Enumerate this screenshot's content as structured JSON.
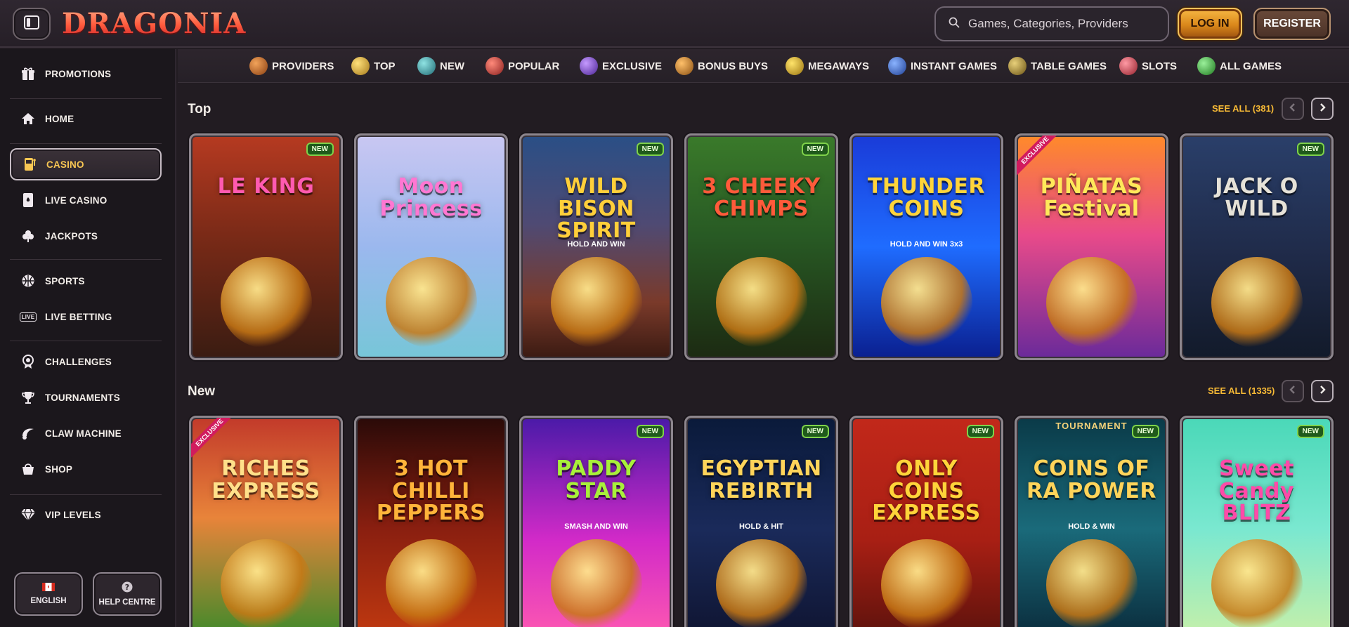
{
  "header": {
    "logo": "DRAGONIA",
    "search_placeholder": "Games, Categories, Providers",
    "login_label": "LOG IN",
    "register_label": "REGISTER"
  },
  "sidebar": {
    "items": [
      {
        "label": "PROMOTIONS",
        "icon": "gift-icon"
      },
      {
        "label": "HOME",
        "icon": "home-icon"
      },
      {
        "label": "CASINO",
        "icon": "slot-machine-icon",
        "active": true
      },
      {
        "label": "LIVE CASINO",
        "icon": "playing-card-icon"
      },
      {
        "label": "JACKPOTS",
        "icon": "clover-icon"
      },
      {
        "label": "SPORTS",
        "icon": "ball-icon"
      },
      {
        "label": "LIVE BETTING",
        "icon": "live-icon"
      },
      {
        "label": "CHALLENGES",
        "icon": "medal-icon"
      },
      {
        "label": "TOURNAMENTS",
        "icon": "trophy-icon"
      },
      {
        "label": "CLAW MACHINE",
        "icon": "claw-icon"
      },
      {
        "label": "SHOP",
        "icon": "bag-icon"
      },
      {
        "label": "VIP LEVELS",
        "icon": "diamond-icon"
      }
    ],
    "language_label": "ENGLISH",
    "help_label": "HELP CENTRE",
    "live_badge": "LIVE"
  },
  "categories": [
    {
      "label": "PROVIDERS",
      "color": "#c8773a"
    },
    {
      "label": "TOP",
      "color": "#e0b53a"
    },
    {
      "label": "NEW",
      "color": "#3aa3a8"
    },
    {
      "label": "POPULAR",
      "color": "#d83b3b"
    },
    {
      "label": "EXCLUSIVE",
      "color": "#7a4bd1"
    },
    {
      "label": "BONUS BUYS",
      "color": "#d88b2e"
    },
    {
      "label": "MEGAWAYS",
      "color": "#e2b61f"
    },
    {
      "label": "INSTANT GAMES",
      "color": "#3b6fd8"
    },
    {
      "label": "TABLE GAMES",
      "color": "#c9a23a"
    },
    {
      "label": "SLOTS",
      "color": "#e04b59"
    },
    {
      "label": "ALL GAMES",
      "color": "#4bc04b"
    }
  ],
  "sections": {
    "top": {
      "title": "Top",
      "see_all": "SEE ALL (381)",
      "games": [
        {
          "title": "LE KING",
          "badge": "NEW",
          "bg": "linear-gradient(180deg,#b63a21 0%,#7a2a17 45%,#3a1c12 100%)",
          "tc": "#ff5ab0"
        },
        {
          "title": "Moon Princess",
          "badge": "",
          "bg": "linear-gradient(180deg,#c9c7f2 0%,#9bb8ee 50%,#77c6d8 100%)",
          "tc": "#ff77d2"
        },
        {
          "title": "WILD BISON SPIRIT",
          "badge": "NEW",
          "bg": "linear-gradient(180deg,#2a4f86 0%,#4f4a73 40%,#7a3a2a 75%,#3a1a12 100%)",
          "tc": "#ffcf3a",
          "sub": "HOLD AND WIN"
        },
        {
          "title": "3 CHEEKY CHIMPS",
          "badge": "NEW",
          "bg": "linear-gradient(180deg,#3a7a2a 0%,#285a24 45%,#1c2a12 100%)",
          "tc": "#ff5a3a"
        },
        {
          "title": "THUNDER COINS",
          "badge": "",
          "bg": "linear-gradient(180deg,#1a3bd8 0%,#1f6cff 50%,#0a1f8f 100%)",
          "tc": "#ffd43a",
          "sub": "HOLD AND WIN 3x3"
        },
        {
          "title": "PIÑATAS Festival",
          "badge": "",
          "exclusive": true,
          "bg": "linear-gradient(180deg,#ff8a2a 0%,#e84a8a 45%,#6a2a9a 100%)",
          "tc": "#ffe85a"
        },
        {
          "title": "JACK O WILD",
          "badge": "NEW",
          "bg": "linear-gradient(180deg,#2a3f6a 0%,#1f2a48 55%,#121a2a 100%)",
          "tc": "#e6e2d8"
        }
      ]
    },
    "new": {
      "title": "New",
      "see_all": "SEE ALL (1335)",
      "games": [
        {
          "title": "RICHES EXPRESS",
          "badge": "",
          "exclusive": true,
          "bg": "linear-gradient(180deg,#c23a2a 0%,#e8843a 45%,#3a8a2a 100%)",
          "tc": "#ffe08a"
        },
        {
          "title": "3 HOT CHILLI PEPPERS",
          "badge": "",
          "bg": "linear-gradient(180deg,#2a0a08 0%,#8a1f10 50%,#c23a10 100%)",
          "tc": "#ffb43a"
        },
        {
          "title": "PADDY STAR",
          "badge": "NEW",
          "bg": "linear-gradient(180deg,#4a1aa8 0%,#d22ac8 55%,#ff5ab0 100%)",
          "tc": "#a8f03a",
          "sub": "SMASH AND WIN"
        },
        {
          "title": "EGYPTIAN REBIRTH",
          "badge": "NEW",
          "bg": "linear-gradient(180deg,#0a1a3a 0%,#1a2a5a 50%,#0f1430 100%)",
          "tc": "#ffd45a",
          "sub": "HOLD & HIT"
        },
        {
          "title": "ONLY COINS EXPRESS",
          "badge": "NEW",
          "bg": "linear-gradient(180deg,#c2281a 0%,#a81f14 55%,#5a120c 100%)",
          "tc": "#ffd43a"
        },
        {
          "title": "COINS OF RA POWER",
          "badge": "NEW",
          "tournament": "TOURNAMENT",
          "bg": "linear-gradient(180deg,#0a3a48 0%,#1a6a7a 50%,#0a2a3a 100%)",
          "tc": "#ffd45a",
          "sub": "HOLD & WIN"
        },
        {
          "title": "Sweet Candy BLITZ",
          "badge": "NEW",
          "bg": "linear-gradient(180deg,#4ad8b8 0%,#7ae8d0 50%,#c8f0a8 100%)",
          "tc": "#ff4aa8"
        }
      ]
    }
  }
}
